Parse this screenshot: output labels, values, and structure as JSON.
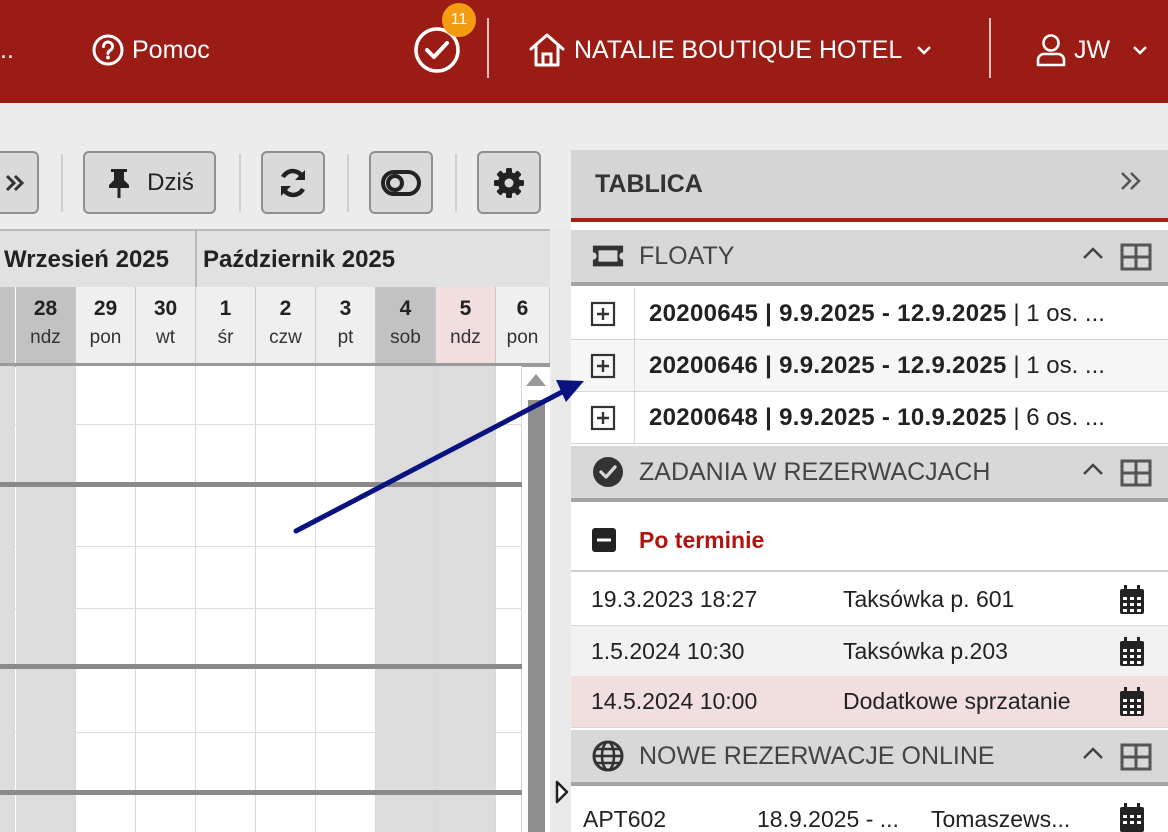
{
  "topbar": {
    "ellipsis": "..",
    "help_label": "Pomoc",
    "tasks_badge": "11",
    "hotel_name": "NATALIE BOUTIQUE HOTEL",
    "user_initials": "JW",
    "bg_color": "#9b1c14"
  },
  "toolbar": {
    "today_label": "Dziś"
  },
  "calendar": {
    "months": [
      "Wrzesień 2025",
      "Październik 2025"
    ],
    "days": [
      {
        "num": "28",
        "name": "ndz"
      },
      {
        "num": "29",
        "name": "pon"
      },
      {
        "num": "30",
        "name": "wt"
      },
      {
        "num": "1",
        "name": "śr"
      },
      {
        "num": "2",
        "name": "czw"
      },
      {
        "num": "3",
        "name": "pt"
      },
      {
        "num": "4",
        "name": "sob"
      },
      {
        "num": "5",
        "name": "ndz"
      },
      {
        "num": "6",
        "name": "pon"
      }
    ]
  },
  "panel": {
    "title": "TABLICA",
    "floats": {
      "title": "FLOATY",
      "rows": [
        {
          "bold": "20200645 | 9.9.2025 - 12.9.2025",
          "rest": " | 1 os. ..."
        },
        {
          "bold": "20200646 | 9.9.2025 - 12.9.2025",
          "rest": " | 1 os. ..."
        },
        {
          "bold": "20200648 | 9.9.2025 - 10.9.2025",
          "rest": " | 6 os. ..."
        }
      ]
    },
    "tasks": {
      "title": "ZADANIA W REZERWACJACH",
      "overdue_label": "Po terminie",
      "rows": [
        {
          "date": "19.3.2023 18:27",
          "name": "Taksówka p. 601"
        },
        {
          "date": "1.5.2024 10:30",
          "name": "Taksówka p.203"
        },
        {
          "date": "14.5.2024 10:00",
          "name": "Dodatkowe sprzatanie"
        }
      ]
    },
    "online": {
      "title": "NOWE REZERWACJE ONLINE",
      "row": {
        "room": "APT602",
        "dates": "18.9.2025 - ...",
        "guest": "Tomaszews..."
      }
    },
    "accent_color": "#a81d15",
    "overdue_color": "#b01410"
  }
}
